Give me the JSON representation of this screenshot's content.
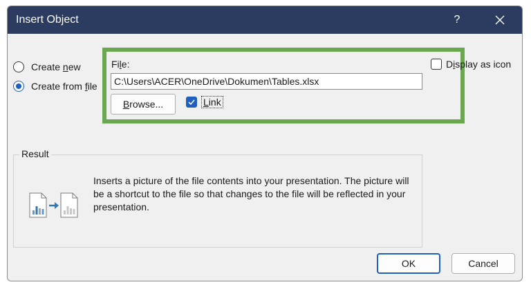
{
  "dialog": {
    "title": "Insert Object",
    "help_label": "?"
  },
  "options": {
    "create_new": {
      "prefix": "Create ",
      "accel": "n",
      "suffix": "ew"
    },
    "create_from_file": {
      "prefix": "Create from ",
      "accel": "f",
      "suffix": "ile"
    },
    "selected": "create_from_file"
  },
  "file": {
    "label_prefix": "Fi",
    "label_accel": "l",
    "label_suffix": "e:",
    "path": "C:\\Users\\ACER\\OneDrive\\Dokumen\\Tables.xlsx"
  },
  "browse": {
    "accel": "B",
    "rest": "rowse..."
  },
  "link": {
    "accel": "L",
    "rest": "ink",
    "checked": true
  },
  "display_as_icon": {
    "prefix": "D",
    "accel": "i",
    "suffix": "splay as icon",
    "checked": false
  },
  "result": {
    "legend": "Result",
    "description": "Inserts a picture of the file contents into your presentation. The picture will be a shortcut to the file so that changes to the file will be reflected in your presentation."
  },
  "buttons": {
    "ok": "OK",
    "cancel": "Cancel"
  },
  "colors": {
    "titlebar": "#2b3c60",
    "highlight": "#6aa84f",
    "accent": "#1f5fbf",
    "dialog_bg": "#f0f0f0"
  },
  "icons": {
    "close": "close-icon",
    "source_file": "chart-file-icon",
    "arrow": "arrow-right-icon",
    "target_file": "chart-file-icon"
  }
}
